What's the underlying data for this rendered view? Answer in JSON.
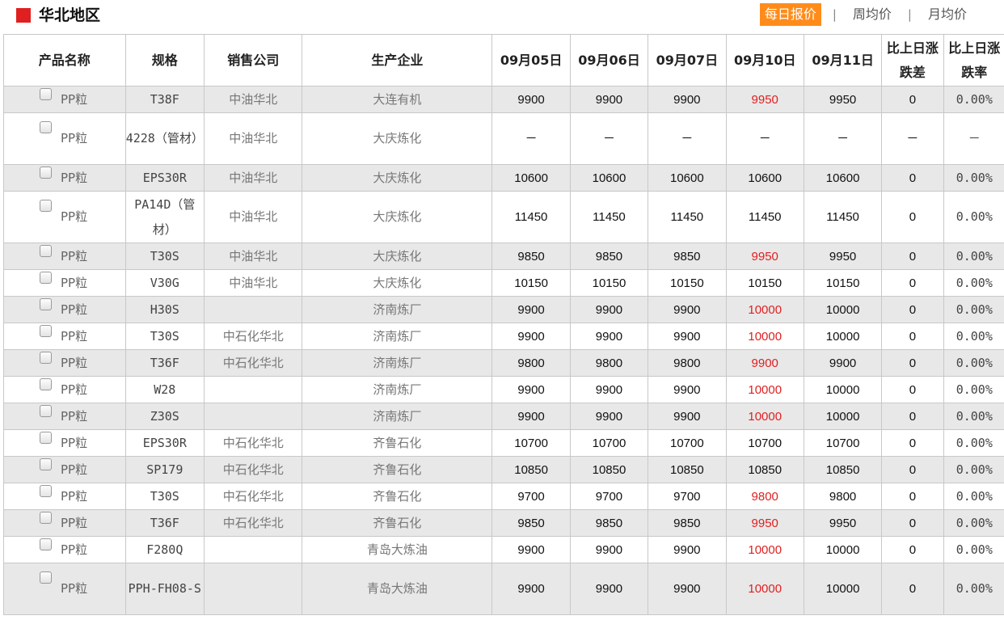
{
  "header": {
    "region_title": "华北地区",
    "tabs": [
      "每日报价",
      "周均价",
      "月均价"
    ],
    "active_tab": "每日报价",
    "separator": "|"
  },
  "colors": {
    "marker": "#e02020",
    "active_tab": "#ff8c1a",
    "price_up": "#e02020",
    "row_alt": "#e8e8e8"
  },
  "table": {
    "headers": {
      "product": "产品名称",
      "spec": "规格",
      "sales": "销售公司",
      "producer": "生产企业",
      "d1": "09月05日",
      "d2": "09月06日",
      "d3": "09月07日",
      "d4": "09月10日",
      "d5": "09月11日",
      "diff": "比上日涨跌差",
      "rate": "比上日涨跌率"
    },
    "rows": [
      {
        "product": "PP粒",
        "spec": "T38F",
        "sales": "中油华北",
        "producer": "大连有机",
        "p": [
          "9900",
          "9900",
          "9900",
          "9950",
          "9950"
        ],
        "diff": "0",
        "rate": "0.00%",
        "up": true
      },
      {
        "product": "PP粒",
        "spec": "4228（管材）",
        "sales": "中油华北",
        "producer": "大庆炼化",
        "p": [
          "－",
          "－",
          "－",
          "－",
          "－"
        ],
        "diff": "－",
        "rate": "－",
        "up": false,
        "tall": true
      },
      {
        "product": "PP粒",
        "spec": "EPS30R",
        "sales": "中油华北",
        "producer": "大庆炼化",
        "p": [
          "10600",
          "10600",
          "10600",
          "10600",
          "10600"
        ],
        "diff": "0",
        "rate": "0.00%",
        "up": false
      },
      {
        "product": "PP粒",
        "spec": "PA14D（管材）",
        "sales": "中油华北",
        "producer": "大庆炼化",
        "p": [
          "11450",
          "11450",
          "11450",
          "11450",
          "11450"
        ],
        "diff": "0",
        "rate": "0.00%",
        "up": false,
        "tall": true
      },
      {
        "product": "PP粒",
        "spec": "T30S",
        "sales": "中油华北",
        "producer": "大庆炼化",
        "p": [
          "9850",
          "9850",
          "9850",
          "9950",
          "9950"
        ],
        "diff": "0",
        "rate": "0.00%",
        "up": true
      },
      {
        "product": "PP粒",
        "spec": "V30G",
        "sales": "中油华北",
        "producer": "大庆炼化",
        "p": [
          "10150",
          "10150",
          "10150",
          "10150",
          "10150"
        ],
        "diff": "0",
        "rate": "0.00%",
        "up": false
      },
      {
        "product": "PP粒",
        "spec": "H30S",
        "sales": "",
        "producer": "济南炼厂",
        "p": [
          "9900",
          "9900",
          "9900",
          "10000",
          "10000"
        ],
        "diff": "0",
        "rate": "0.00%",
        "up": true
      },
      {
        "product": "PP粒",
        "spec": "T30S",
        "sales": "中石化华北",
        "producer": "济南炼厂",
        "p": [
          "9900",
          "9900",
          "9900",
          "10000",
          "10000"
        ],
        "diff": "0",
        "rate": "0.00%",
        "up": true
      },
      {
        "product": "PP粒",
        "spec": "T36F",
        "sales": "中石化华北",
        "producer": "济南炼厂",
        "p": [
          "9800",
          "9800",
          "9800",
          "9900",
          "9900"
        ],
        "diff": "0",
        "rate": "0.00%",
        "up": true
      },
      {
        "product": "PP粒",
        "spec": "W28",
        "sales": "",
        "producer": "济南炼厂",
        "p": [
          "9900",
          "9900",
          "9900",
          "10000",
          "10000"
        ],
        "diff": "0",
        "rate": "0.00%",
        "up": true
      },
      {
        "product": "PP粒",
        "spec": "Z30S",
        "sales": "",
        "producer": "济南炼厂",
        "p": [
          "9900",
          "9900",
          "9900",
          "10000",
          "10000"
        ],
        "diff": "0",
        "rate": "0.00%",
        "up": true
      },
      {
        "product": "PP粒",
        "spec": "EPS30R",
        "sales": "中石化华北",
        "producer": "齐鲁石化",
        "p": [
          "10700",
          "10700",
          "10700",
          "10700",
          "10700"
        ],
        "diff": "0",
        "rate": "0.00%",
        "up": false
      },
      {
        "product": "PP粒",
        "spec": "SP179",
        "sales": "中石化华北",
        "producer": "齐鲁石化",
        "p": [
          "10850",
          "10850",
          "10850",
          "10850",
          "10850"
        ],
        "diff": "0",
        "rate": "0.00%",
        "up": false
      },
      {
        "product": "PP粒",
        "spec": "T30S",
        "sales": "中石化华北",
        "producer": "齐鲁石化",
        "p": [
          "9700",
          "9700",
          "9700",
          "9800",
          "9800"
        ],
        "diff": "0",
        "rate": "0.00%",
        "up": true
      },
      {
        "product": "PP粒",
        "spec": "T36F",
        "sales": "中石化华北",
        "producer": "齐鲁石化",
        "p": [
          "9850",
          "9850",
          "9850",
          "9950",
          "9950"
        ],
        "diff": "0",
        "rate": "0.00%",
        "up": true
      },
      {
        "product": "PP粒",
        "spec": "F280Q",
        "sales": "",
        "producer": "青岛大炼油",
        "p": [
          "9900",
          "9900",
          "9900",
          "10000",
          "10000"
        ],
        "diff": "0",
        "rate": "0.00%",
        "up": true
      },
      {
        "product": "PP粒",
        "spec": "PPH-FH08-S",
        "sales": "",
        "producer": "青岛大炼油",
        "p": [
          "9900",
          "9900",
          "9900",
          "10000",
          "10000"
        ],
        "diff": "0",
        "rate": "0.00%",
        "up": true,
        "tall": true
      }
    ]
  }
}
